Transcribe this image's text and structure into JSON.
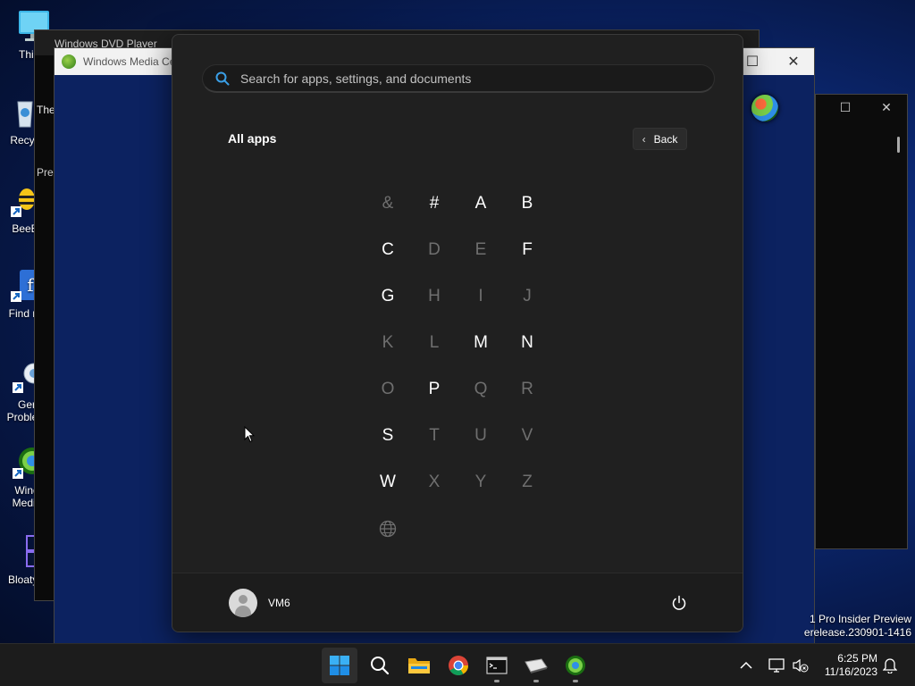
{
  "desktop": {
    "icons": [
      {
        "label": "This P"
      },
      {
        "label": "Recyc"
      },
      {
        "label": "BeeB"
      },
      {
        "label": "Find m"
      },
      {
        "label": "Ger"
      },
      {
        "label": "Problem"
      },
      {
        "label": "Wind"
      },
      {
        "label": "Media"
      },
      {
        "label": "BloatyN"
      }
    ],
    "partial_labels": [
      "The",
      "Pre"
    ]
  },
  "windows": {
    "dvd_player": {
      "title": "Windows DVD Player"
    },
    "media_center": {
      "title": "Windows Media Ce"
    },
    "terminal": {}
  },
  "watermark": {
    "line1": "1 Pro Insider Preview",
    "line2": "erelease.230901-1416"
  },
  "start_menu": {
    "search": {
      "placeholder": "Search for apps, settings, and documents"
    },
    "title": "All apps",
    "back_label": "Back",
    "letters": [
      {
        "char": "&",
        "enabled": false
      },
      {
        "char": "#",
        "enabled": true
      },
      {
        "char": "A",
        "enabled": true
      },
      {
        "char": "B",
        "enabled": true
      },
      {
        "char": "C",
        "enabled": true
      },
      {
        "char": "D",
        "enabled": false
      },
      {
        "char": "E",
        "enabled": false
      },
      {
        "char": "F",
        "enabled": true
      },
      {
        "char": "G",
        "enabled": true
      },
      {
        "char": "H",
        "enabled": false
      },
      {
        "char": "I",
        "enabled": false
      },
      {
        "char": "J",
        "enabled": false
      },
      {
        "char": "K",
        "enabled": false
      },
      {
        "char": "L",
        "enabled": false
      },
      {
        "char": "M",
        "enabled": true
      },
      {
        "char": "N",
        "enabled": true
      },
      {
        "char": "O",
        "enabled": false
      },
      {
        "char": "P",
        "enabled": true
      },
      {
        "char": "Q",
        "enabled": false
      },
      {
        "char": "R",
        "enabled": false
      },
      {
        "char": "S",
        "enabled": true
      },
      {
        "char": "T",
        "enabled": false
      },
      {
        "char": "U",
        "enabled": false
      },
      {
        "char": "V",
        "enabled": false
      },
      {
        "char": "W",
        "enabled": true
      },
      {
        "char": "X",
        "enabled": false
      },
      {
        "char": "Y",
        "enabled": false
      },
      {
        "char": "Z",
        "enabled": false
      }
    ],
    "globe_icon": "globe-icon",
    "user": {
      "name": "VM6"
    },
    "power_icon": "power-icon"
  },
  "taskbar": {
    "apps": [
      {
        "name": "start",
        "icon": "windows-logo-icon",
        "active": true
      },
      {
        "name": "search",
        "icon": "search-icon",
        "active": false
      },
      {
        "name": "file-explorer",
        "icon": "folder-icon",
        "active": false
      },
      {
        "name": "chrome",
        "icon": "chrome-icon",
        "active": false
      },
      {
        "name": "terminal",
        "icon": "terminal-icon",
        "active": false,
        "running": true
      },
      {
        "name": "dvd-player",
        "icon": "dvd-player-icon",
        "active": false,
        "running": true
      },
      {
        "name": "media-center",
        "icon": "media-center-icon",
        "active": false,
        "running": true
      }
    ],
    "clock": {
      "time": "6:25 PM",
      "date": "11/16/2023"
    }
  },
  "colors": {
    "start_bg": "#202020",
    "accent_blue": "#2f8fe6",
    "disabled_letter": "#6f6f6f"
  }
}
